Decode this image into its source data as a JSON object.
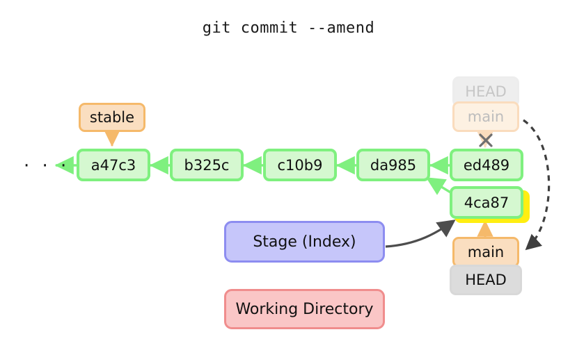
{
  "title": "git commit --amend",
  "colors": {
    "commit_border": "#7ff07f",
    "commit_fill": "#d5f8d0",
    "ref_orange_border": "#f5b96a",
    "ref_orange_fill": "#fadec0",
    "ref_gray_fill": "#dcdcdc",
    "highlight": "#ffee11",
    "stage_border": "#8d8df0",
    "stage_fill": "#c6c6fa",
    "working_dir_border": "#f08d8d",
    "working_dir_fill": "#fac6c6",
    "faded_text": "#bdbdbd",
    "arrow_dark": "#4d4d4d"
  },
  "graph": {
    "ellipsis": "· · ·",
    "commits": [
      {
        "id": "a47c3",
        "label": "a47c3"
      },
      {
        "id": "b325c",
        "label": "b325c"
      },
      {
        "id": "c10b9",
        "label": "c10b9"
      },
      {
        "id": "da985",
        "label": "da985"
      },
      {
        "id": "ed489",
        "label": "ed489"
      },
      {
        "id": "4ca87",
        "label": "4ca87"
      }
    ],
    "refs": [
      {
        "id": "stable",
        "label": "stable",
        "style": "orange",
        "points_to": "a47c3"
      },
      {
        "id": "head-old",
        "label": "HEAD",
        "style": "gray-faded",
        "points_to": "ed489"
      },
      {
        "id": "main-old",
        "label": "main",
        "style": "orange-faded",
        "points_to": "ed489"
      },
      {
        "id": "main-new",
        "label": "main",
        "style": "orange",
        "points_to": "4ca87"
      },
      {
        "id": "head-new",
        "label": "HEAD",
        "style": "gray",
        "points_to": "main-new"
      }
    ],
    "marks": [
      {
        "id": "detach-cross",
        "label": "×",
        "meaning": "old main pointer removed"
      }
    ],
    "highlighted_commit": "4ca87"
  },
  "areas": [
    {
      "id": "stage",
      "label": "Stage (Index)"
    },
    {
      "id": "working-directory",
      "label": "Working Directory"
    }
  ]
}
